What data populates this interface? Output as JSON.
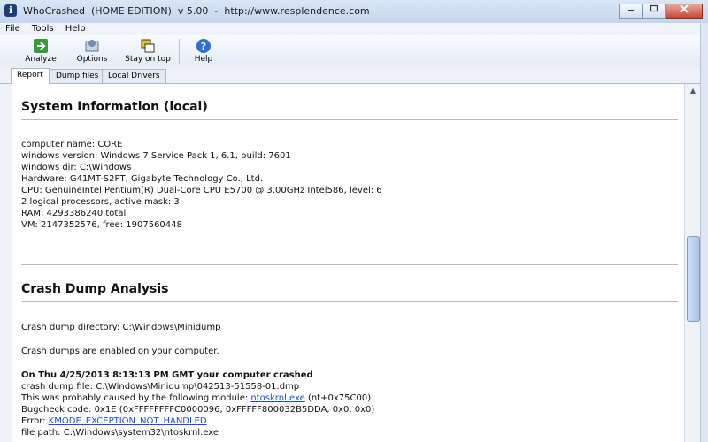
{
  "window": {
    "title": "WhoCrashed  (HOME EDITION)  v 5.00  -  http://www.resplendence.com",
    "app_icon_glyph": "ℹ"
  },
  "menu": [
    "File",
    "Tools",
    "Help"
  ],
  "toolbar": {
    "analyze": "Analyze",
    "options": "Options",
    "stay_on_top": "Stay on top",
    "help": "Help"
  },
  "tabs": [
    "Report",
    "Dump files",
    "Local Drivers"
  ],
  "report": {
    "system_heading": "System Information (local)",
    "system_lines": [
      "computer name: CORE",
      "windows version: Windows 7 Service Pack 1, 6.1, build: 7601",
      "windows dir: C:\\Windows",
      "Hardware: G41MT-S2PT, Gigabyte Technology Co., Ltd.",
      "CPU: GenuineIntel Pentium(R) Dual-Core CPU E5700 @ 3.00GHz Intel586, level: 6",
      "2 logical processors, active mask: 3",
      "RAM: 4293386240 total",
      "VM: 2147352576, free: 1907560448"
    ],
    "crash_heading": "Crash Dump Analysis",
    "dump_directory": "Crash dump directory: C:\\Windows\\Minidump",
    "dumps_enabled": "Crash dumps are enabled on your computer.",
    "crash_title": "On Thu 4/25/2013 8:13:13 PM GMT your computer crashed",
    "dump_file": "crash dump file: C:\\Windows\\Minidump\\042513-51558-01.dmp",
    "module_prefix": "This was probably caused by the following module: ",
    "module_link": "ntoskrnl.exe",
    "module_suffix": " (nt+0x75C00)",
    "bugcheck": "Bugcheck code: 0x1E (0xFFFFFFFFC0000096, 0xFFFFF800032B5DDA, 0x0, 0x0)",
    "error_prefix": "Error: ",
    "error_link": "KMODE_EXCEPTION_NOT_HANDLED",
    "file_path": "file path: C:\\Windows\\system32\\ntoskrnl.exe"
  }
}
